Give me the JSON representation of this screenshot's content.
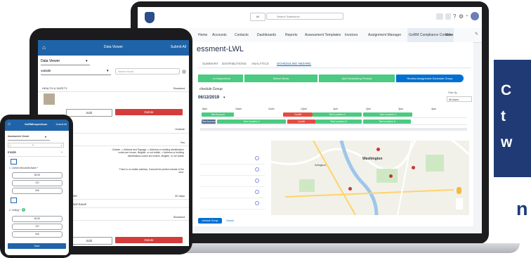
{
  "laptop": {
    "search_scope": "All",
    "search_placeholder": "Search Salesforce",
    "nav": [
      "Home",
      "Accounts",
      "Contacts",
      "Dashboards",
      "Reports",
      "Assessment Templates",
      "Invoices",
      "Assignment Manager",
      "GoRM Compliance Console",
      "More"
    ],
    "page_title": "essment-LWL",
    "tabs": [
      "SUMMARY",
      "DISTRIBUTIONS",
      "ANALYTICS",
      "SCHEDULING WIZARD"
    ],
    "path_steps": [
      "...nt Inspections",
      "Select Views",
      "Add Scheduling Periods",
      "Review Assignment Schedule Group"
    ],
    "section_title": "chedule Group",
    "date": "06/12/2019",
    "filter_label": "Filter By",
    "filter_value": "All Users",
    "times": [
      "8am",
      "10am",
      "11am",
      "12pm",
      "1pm",
      "2pm",
      "3pm",
      "4pm"
    ],
    "bars": [
      "Test Account",
      "Test Location 2",
      "Conflit",
      "Test Location 4",
      "Test Location 5",
      "Test Location 3",
      "Conflit",
      "Test Location 6"
    ],
    "map_labels": [
      "Arlington",
      "Washington"
    ],
    "buttons": {
      "save": "chedule Group",
      "cancel": "Cancel"
    }
  },
  "tablet": {
    "title": "Data Viewer",
    "submit": "Submit All",
    "viewer_select": "Data Viewer",
    "scope_select": "outside",
    "search_placeholder": "Search record",
    "health_label": "HEALTH & SAFETY",
    "standard": "Standard",
    "edit": "Edit",
    "delete": "Delete",
    "outside": "Outside",
    "yes": "Yes",
    "address_text": "Outside -> Address and Signage -> Address or building identification codes are known, illegible, or not visible -> Address or building identification codes are broken, illegible, or not visible",
    "no_address": "There is no visible address. It should be printed outside of the door.",
    "days": "30 days",
    "frame1": "FRAME",
    "frame2": "STANDFRAME",
    "standard2": "Standard",
    "edit2": "Edit",
    "delete2": "Delete"
  },
  "phone": {
    "title": "GoRMInspections",
    "submit": "Submit All",
    "viewer": "Assessment Viewer",
    "section": "Inside",
    "q1": "1. Carbon Monoxide Alarm *",
    "options1": [
      "N/OO",
      "OO",
      "N/A"
    ],
    "q2": "2. Ceiling *",
    "badge": "1",
    "options2": [
      "N/OO",
      "OO",
      "N/A"
    ],
    "save": "Save"
  },
  "promo": {
    "lines": [
      "C",
      "t",
      "w"
    ],
    "bottom": "n"
  },
  "colors": {
    "salesforce_blue": "#1f63a8",
    "path_green": "#4bca81",
    "path_active": "#0070d2",
    "delete_red": "#d43c3c",
    "promo_navy": "#1f3a75"
  }
}
